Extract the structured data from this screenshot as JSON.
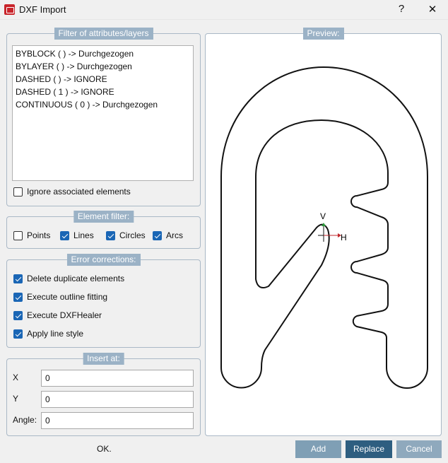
{
  "window": {
    "title": "DXF Import",
    "help": "?",
    "close": "✕"
  },
  "filter": {
    "legend": "Filter of attributes/layers",
    "items": [
      "BYBLOCK ( ) -> Durchgezogen",
      "BYLAYER ( ) -> Durchgezogen",
      "DASHED ( ) -> IGNORE",
      "DASHED ( 1 ) -> IGNORE",
      "CONTINUOUS ( 0 ) -> Durchgezogen"
    ],
    "ignore_label": "Ignore associated elements",
    "ignore_checked": false
  },
  "element_filter": {
    "legend": "Element filter:",
    "points": "Points",
    "lines": "Lines",
    "circles": "Circles",
    "arcs": "Arcs"
  },
  "errors": {
    "legend": "Error corrections:",
    "items": [
      "Delete duplicate elements",
      "Execute outline fitting",
      "Execute DXFHealer",
      "Apply line style"
    ]
  },
  "insert": {
    "legend": "Insert at:",
    "x_label": "X",
    "x": "0",
    "y_label": "Y",
    "y": "0",
    "angle_label": "Angle:",
    "angle": "0"
  },
  "preview": {
    "legend": "Preview:",
    "v": "V",
    "h": "H"
  },
  "footer": {
    "ok": "OK.",
    "add": "Add",
    "replace": "Replace",
    "cancel": "Cancel"
  }
}
